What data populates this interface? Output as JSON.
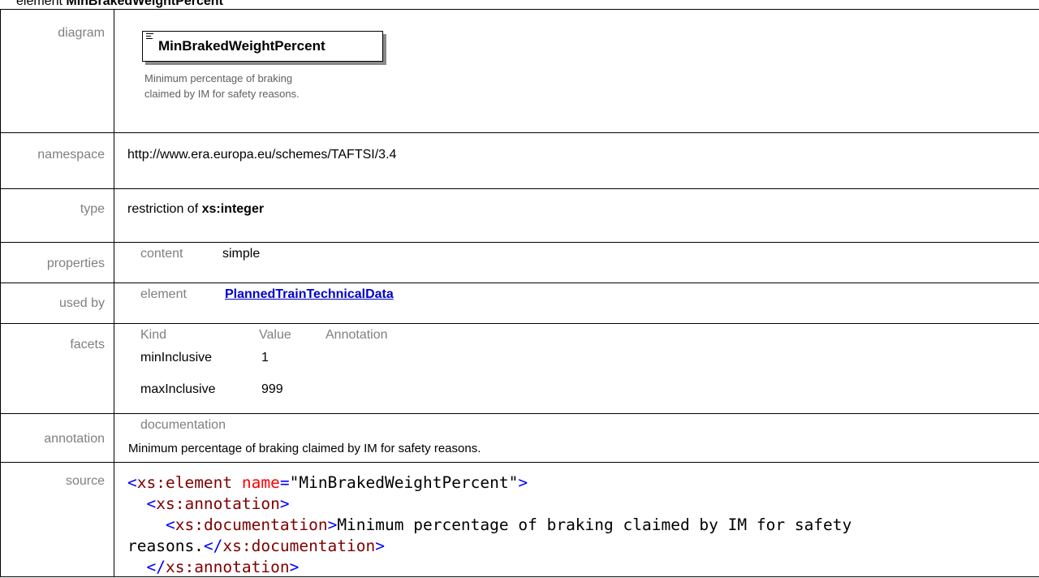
{
  "header": {
    "prefix": "element ",
    "name": "MinBrakedWeightPercent"
  },
  "rows": {
    "diagram": {
      "label": "diagram",
      "box_name": "MinBrakedWeightPercent",
      "description": "Minimum percentage of braking claimed by IM for safety reasons."
    },
    "namespace": {
      "label": "namespace",
      "value": "http://www.era.europa.eu/schemes/TAFTSI/3.4"
    },
    "type": {
      "label": "type",
      "prefix": "restriction of ",
      "base": "xs:integer"
    },
    "properties": {
      "label": "properties",
      "key": "content",
      "value": "simple"
    },
    "used_by": {
      "label": "used by",
      "key": "element",
      "link": "PlannedTrainTechnicalData"
    },
    "facets": {
      "label": "facets",
      "headers": [
        "Kind",
        "Value",
        "Annotation"
      ],
      "items": [
        {
          "kind": "minInclusive",
          "value": "1"
        },
        {
          "kind": "maxInclusive",
          "value": "999"
        }
      ]
    },
    "annotation": {
      "label": "annotation",
      "key": "documentation",
      "text": "Minimum percentage of braking claimed by IM for safety reasons."
    },
    "source": {
      "label": "source",
      "line1_open": "<",
      "line1_tag": "xs:element",
      "line1_attr": " name",
      "line1_eq": "=",
      "line1_val": "\"MinBrakedWeightPercent\"",
      "line1_close": ">",
      "line2_open": "<",
      "line2_tag": "xs:annotation",
      "line2_close": ">",
      "line3_open": "<",
      "line3_tag": "xs:documentation",
      "line3_close": ">",
      "line3_text": "Minimum percentage of braking claimed by IM for safety",
      "line4_text": "reasons.",
      "line4_open": "</",
      "line4_tag": "xs:documentation",
      "line4_close": ">",
      "line5_open": "</",
      "line5_tag": "xs:annotation",
      "line5_close": ">"
    }
  }
}
